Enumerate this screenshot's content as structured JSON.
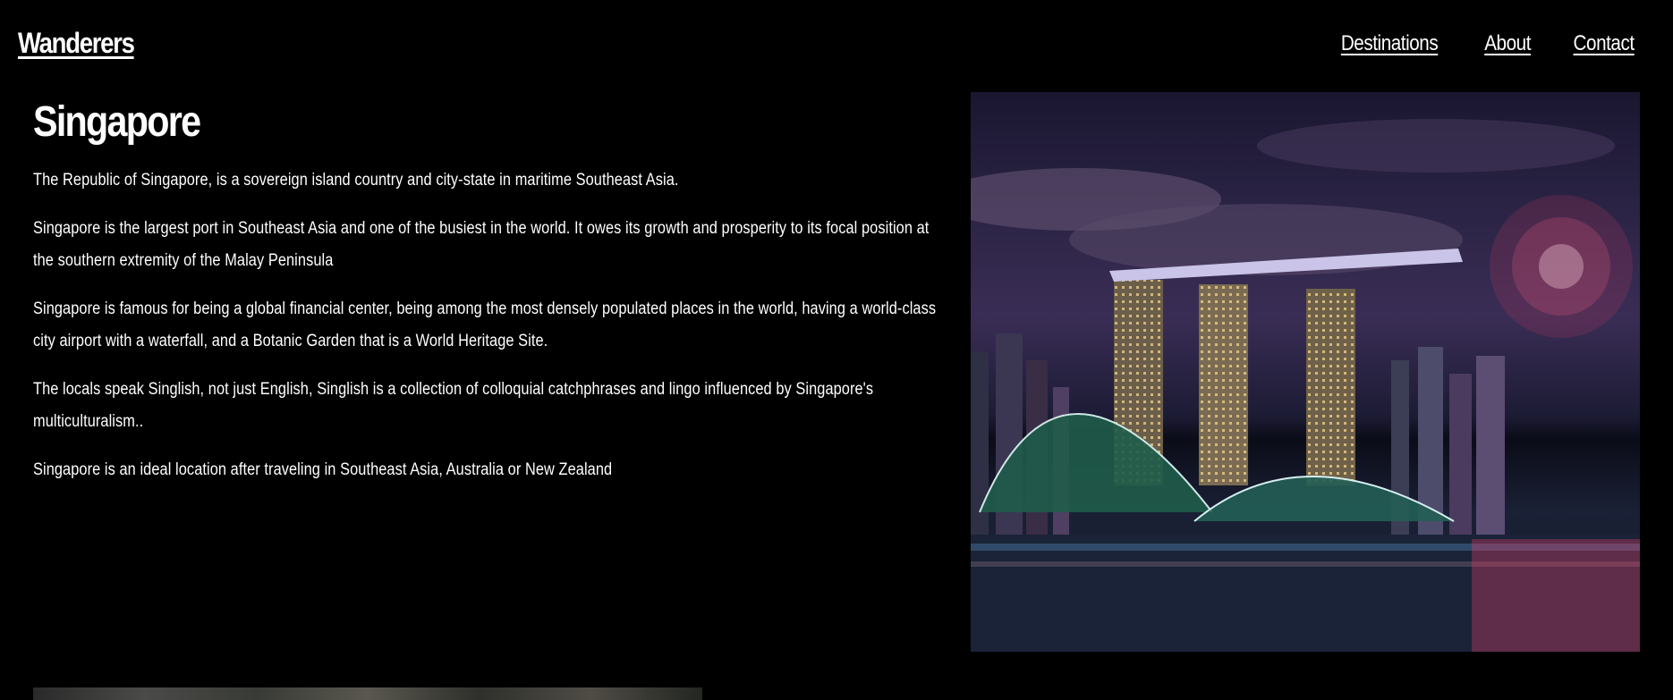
{
  "header": {
    "brand": "Wanderers",
    "nav": [
      "Destinations",
      "About",
      "Contact"
    ]
  },
  "main": {
    "title": "Singapore",
    "paragraphs": [
      "The Republic of Singapore, is a sovereign island country and city-state in maritime Southeast Asia.",
      "Singapore is the largest port in Southeast Asia and one of the busiest in the world. It owes its growth and prosperity to its focal position at the southern extremity of the Malay Peninsula",
      "Singapore is famous for being a global financial center, being among the most densely populated places in the world, having a world-class city airport with a waterfall, and a Botanic Garden that is a World Heritage Site.",
      "The locals speak Singlish, not just English, Singlish is a collection of colloquial catchphrases and lingo influenced by Singapore's multiculturalism..",
      "Singapore is an ideal location after traveling in Southeast Asia, Australia or New Zealand"
    ]
  },
  "colors": {
    "background": "#000000",
    "text": "#ffffff"
  }
}
